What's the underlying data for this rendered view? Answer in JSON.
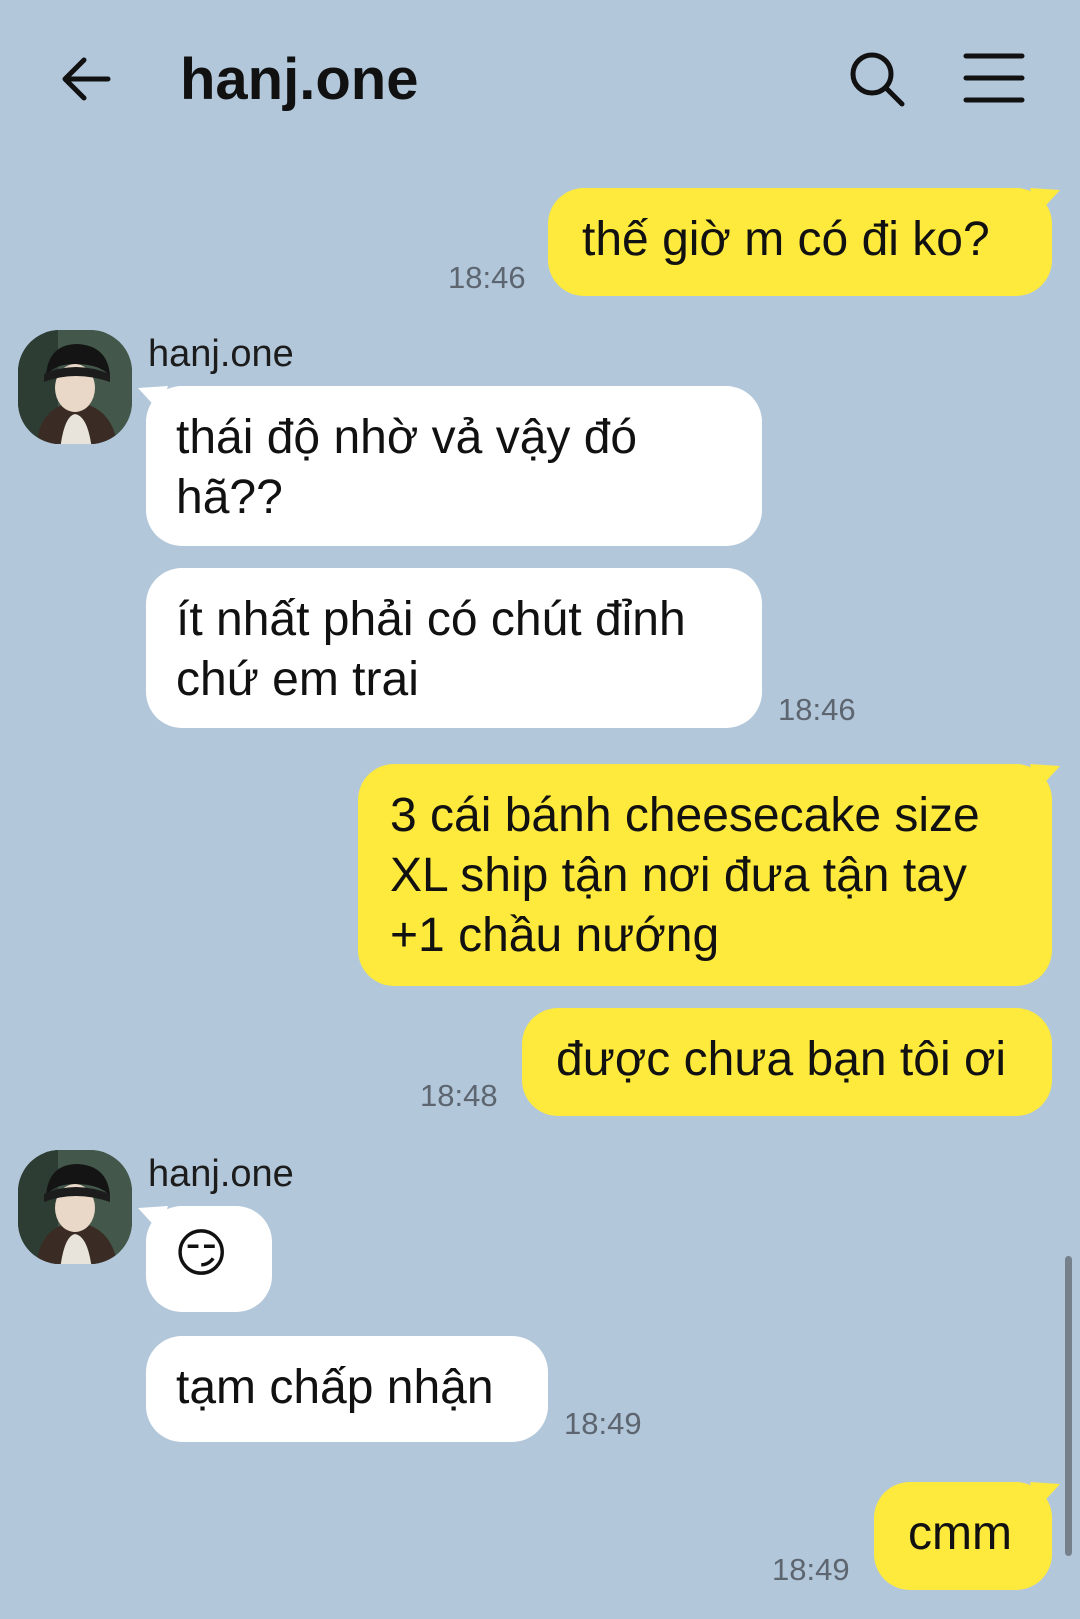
{
  "header": {
    "title": "hanj.one",
    "back_icon": "arrow-left-icon",
    "search_icon": "search-icon",
    "menu_icon": "hamburger-menu-icon"
  },
  "colors": {
    "background": "#b2c7da",
    "my_bubble": "#fee93d",
    "their_bubble": "#ffffff",
    "timestamp": "#5d6670"
  },
  "messages": [
    {
      "from": "me",
      "text": "thế giờ m có đi ko?",
      "time": "18:46"
    },
    {
      "from": "them",
      "sender": "hanj.one",
      "text_lines": [
        "thái độ nhờ vả vậy đó",
        "hã??"
      ]
    },
    {
      "from": "them",
      "text_lines": [
        "ít nhất phải có chút đỉnh",
        "chứ em trai"
      ],
      "time": "18:46"
    },
    {
      "from": "me",
      "text_lines": [
        "3 cái bánh cheesecake size",
        "XL ship tận nơi đưa tận tay",
        "+1 chầu nướng"
      ]
    },
    {
      "from": "me",
      "text": "được chưa bạn tôi ơi",
      "time": "18:48"
    },
    {
      "from": "them",
      "sender": "hanj.one",
      "text": "😏"
    },
    {
      "from": "them",
      "text": "tạm chấp nhận",
      "time": "18:49"
    },
    {
      "from": "me",
      "text": "cmm",
      "time": "18:49"
    }
  ]
}
